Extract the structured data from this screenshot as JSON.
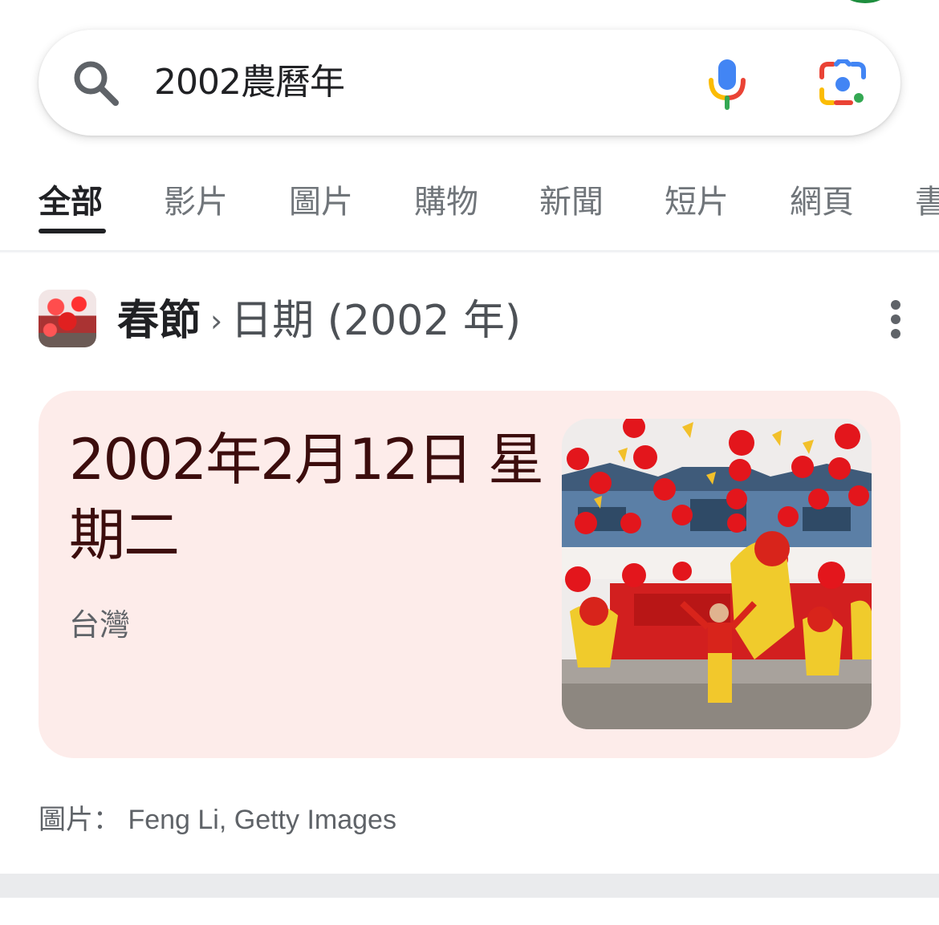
{
  "search": {
    "query": "2002農曆年"
  },
  "tabs": [
    {
      "label": "全部",
      "active": true
    },
    {
      "label": "影片"
    },
    {
      "label": "圖片"
    },
    {
      "label": "購物"
    },
    {
      "label": "新聞"
    },
    {
      "label": "短片"
    },
    {
      "label": "網頁"
    },
    {
      "label": "書"
    }
  ],
  "result": {
    "entity": "春節",
    "separator": "›",
    "attribute": "日期 (2002 年)",
    "answer": "2002年2月12日 星期二",
    "region": "台灣",
    "credit_label": "圖片：",
    "credit_text": "Feng Li, Getty Images"
  },
  "icons": {
    "search": "search-icon",
    "mic": "microphone-icon",
    "lens": "google-lens-icon",
    "more": "more-vert-icon"
  },
  "colors": {
    "card_background": "#fdecea",
    "answer_text": "#3c0d0d",
    "mic_blue": "#4285f4",
    "mic_red": "#ea4335",
    "mic_yellow": "#fbbc04",
    "mic_green": "#34a853"
  }
}
